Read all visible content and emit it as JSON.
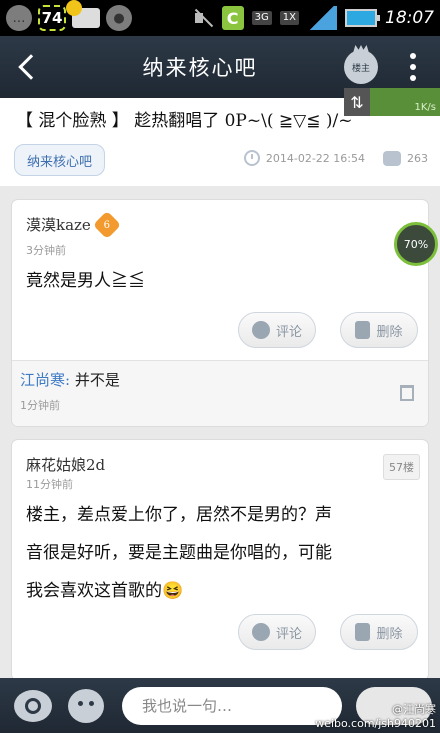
{
  "status_bar": {
    "battery_badge": "74",
    "net_type": "3G",
    "net_sub": "1X",
    "time": "18:07"
  },
  "header": {
    "title": "纳来核心吧",
    "crown_label": "楼主"
  },
  "post": {
    "title": "【 混个脸熟 】 趁热翻唱了 0P~\\( ≧▽≦ )/~",
    "forum_tag": "纳来核心吧",
    "date": "2014-02-22 16:54",
    "reply_count": "263"
  },
  "speed": {
    "upload_arrow": "⇅",
    "rate": "1K/s",
    "circle": "70%"
  },
  "replies": [
    {
      "author": "漠漠kaze",
      "level": "6",
      "ago": "3分钟前",
      "content": "竟然是男人≧≦",
      "comment_label": "评论",
      "delete_label": "删除",
      "sub_reply": {
        "name": "江尚寒:",
        "text": "并不是",
        "ago": "1分钟前"
      }
    },
    {
      "author": "麻花姑娘2d",
      "ago": "11分钟前",
      "floor": "57楼",
      "content_line1": "楼主，差点爱上你了，居然不是男的？声",
      "content_line2": "音很是好听，要是主题曲是你唱的，可能",
      "content_line3": "我会喜欢这首歌的",
      "emoji": "😆",
      "comment_label": "评论",
      "delete_label": "删除"
    }
  ],
  "bottom": {
    "input_placeholder": "我也说一句…",
    "watermark_line1": "@江尚寒",
    "watermark_line2": "weibo.com/jsh940201"
  },
  "colors": {
    "header_bg": "#2d3947",
    "accent_blue": "#3e7bc5",
    "level_orange": "#f29a2e"
  }
}
